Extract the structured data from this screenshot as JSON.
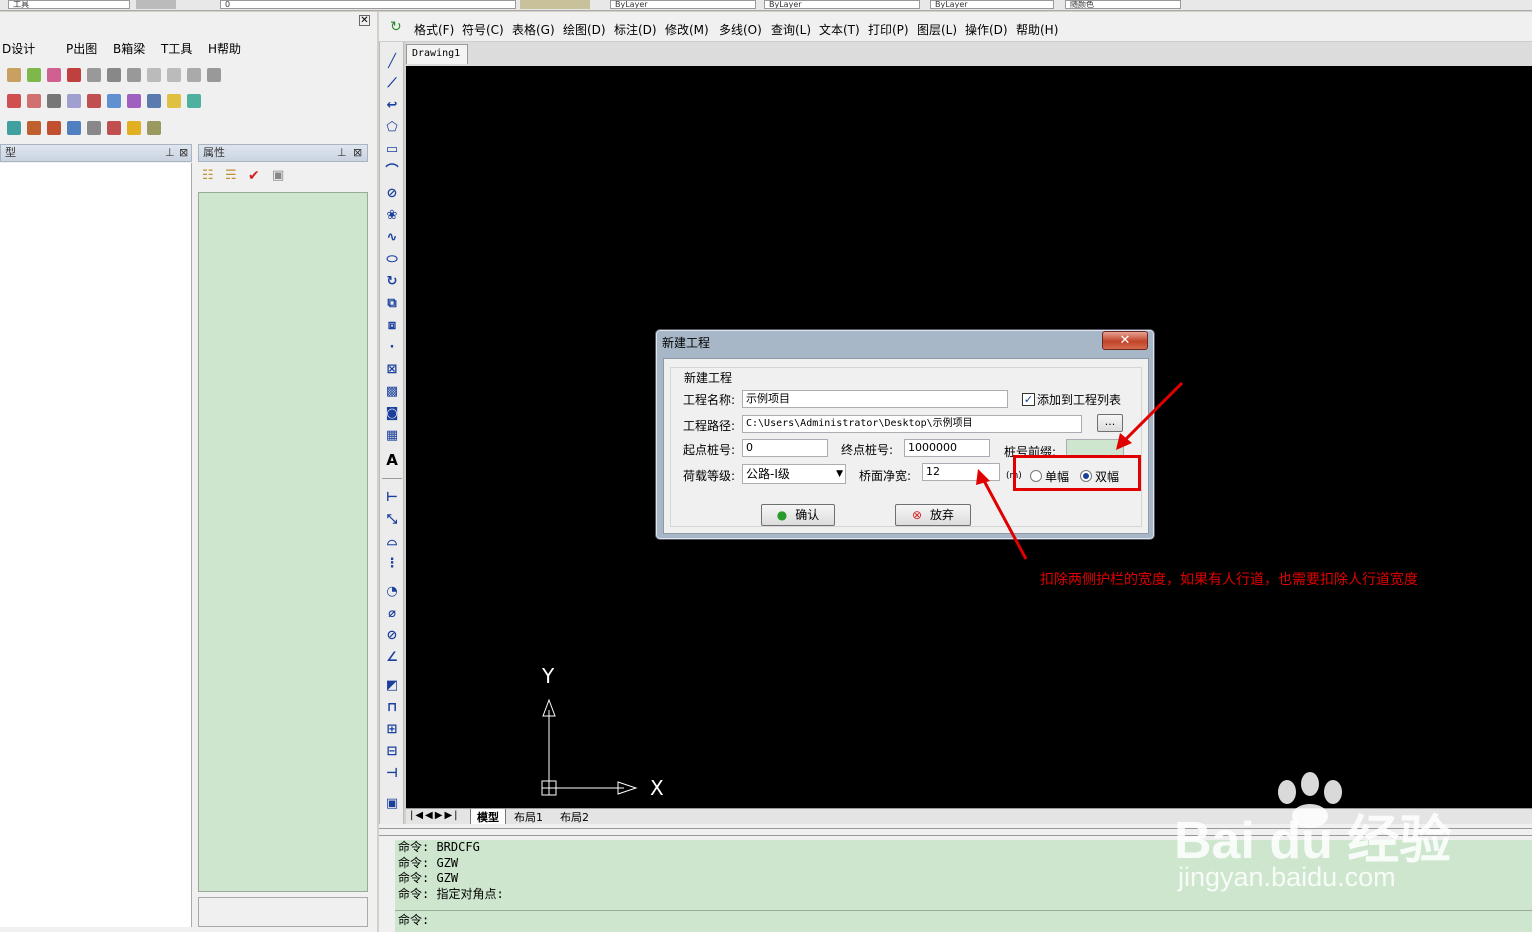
{
  "top_combos": {
    "c1": "工具",
    "c2": "0",
    "c3": "ByLayer",
    "c4": "ByLayer",
    "c5": "ByLayer",
    "c6": "随颜色"
  },
  "left_menu": [
    "D设计",
    "P出图",
    "B箱梁",
    "T工具",
    "H帮助"
  ],
  "panels": {
    "left_title": "型",
    "right_title": "属性"
  },
  "main_menu": [
    "格式(F)",
    "符号(C)",
    "表格(G)",
    "绘图(D)",
    "标注(D)",
    "修改(M)",
    "多线(O)",
    "查询(L)",
    "文本(T)",
    "打印(P)",
    "图层(L)",
    "操作(D)",
    "帮助(H)"
  ],
  "doc_tab": "Drawing1",
  "layout_tabs": [
    "模型",
    "布局1",
    "布局2"
  ],
  "axis": {
    "y": "Y",
    "x": "X"
  },
  "command_lines": [
    "命令: BRDCFG",
    "命令: GZW",
    "命令: GZW",
    "命令: 指定对角点:"
  ],
  "command_prompt": "命令:",
  "dialog": {
    "title": "新建工程",
    "group_label": "新建工程",
    "name_label": "工程名称:",
    "name_value": "示例项目",
    "add_to_list_label": "添加到工程列表",
    "add_to_list_checked": true,
    "path_label": "工程路径:",
    "path_value": "C:\\Users\\Administrator\\Desktop\\示例项目",
    "browse_label": "...",
    "start_label": "起点桩号:",
    "start_value": "0",
    "end_label": "终点桩号:",
    "end_value": "1000000",
    "prefix_label": "桩号前缀:",
    "prefix_value": "",
    "load_label": "荷载等级:",
    "load_value": "公路-I级",
    "width_label": "桥面净宽:",
    "width_value": "12",
    "width_unit": "(m)",
    "radio_single": "单幅",
    "radio_double": "双幅",
    "radio_selected": "双幅",
    "ok_label": "确认",
    "cancel_label": "放弃"
  },
  "annotation_text": "扣除两侧护栏的宽度，如果有人行道，也需要扣除人行道宽度",
  "watermark": {
    "brand": "Bai du 经验",
    "url": "jingyan.baidu.com"
  },
  "colors": {
    "panel_green": "#cde6cd",
    "annotation_red": "#e00000",
    "canvas": "#000000"
  }
}
